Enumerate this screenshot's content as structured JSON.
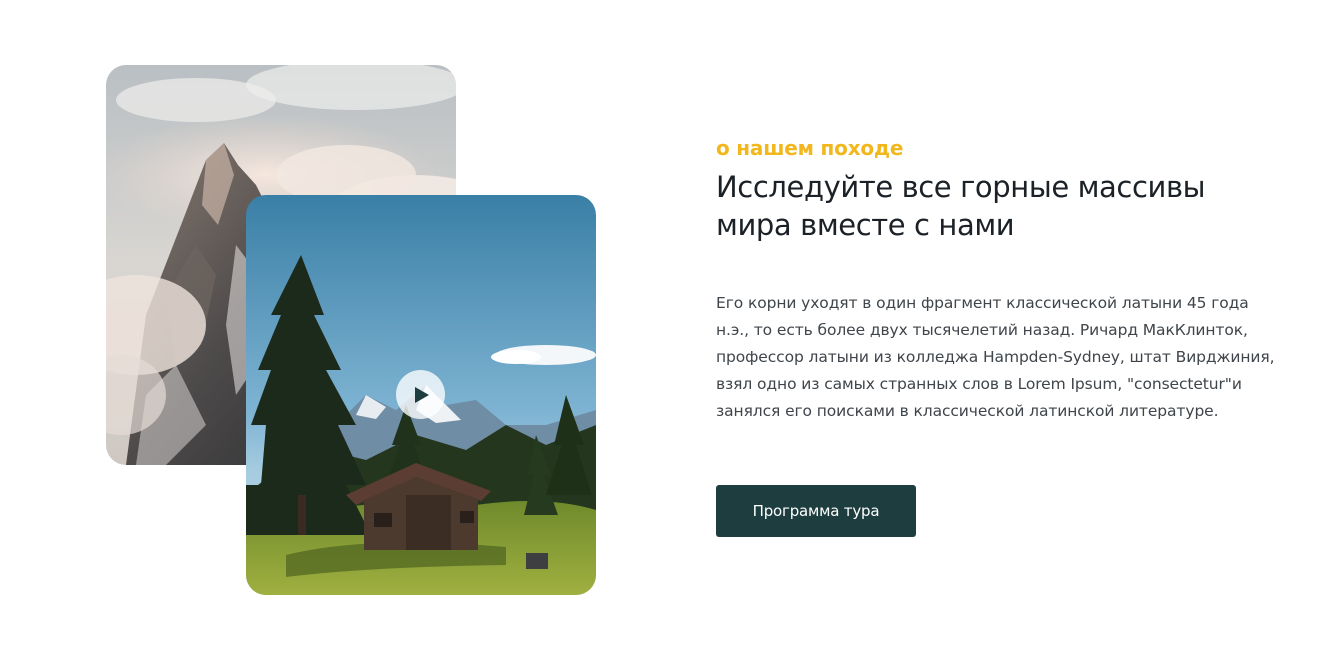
{
  "about": {
    "eyebrow": "о нашем походе",
    "heading": "Исследуйте все горные массивы мира вместе с нами",
    "body": "Его корни уходят в один фрагмент классической латыни 45 года н.э., то есть более двух тысячелетий назад. Ричард МакКлинток, профессор латыни из колледжа Hampden-Sydney, штат Вирджиния, взял одно из самых странных слов в Lorem Ipsum, \"consectetur\"и занялся его поисками в классической латинской литературе.",
    "cta_label": "Программа тура"
  },
  "media": {
    "photo_1_subject": "mountain-peak-in-clouds",
    "photo_2_subject": "wooden-cabin-in-alpine-meadow",
    "play_icon": "play-icon"
  },
  "colors": {
    "accent": "#f1b71c",
    "heading": "#1b2126",
    "body": "#3f454a",
    "button_bg": "#1d3d3f",
    "button_text": "#ffffff"
  }
}
